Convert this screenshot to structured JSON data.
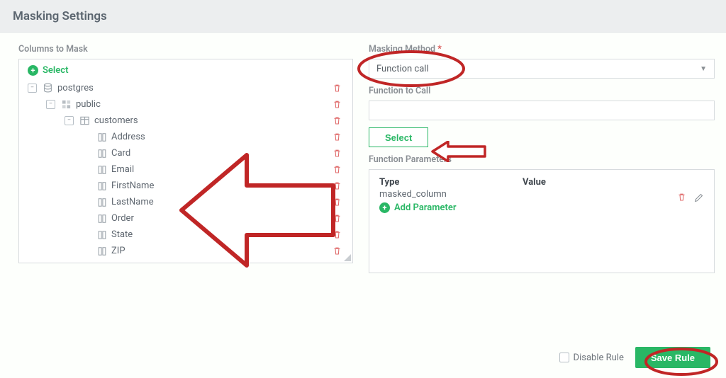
{
  "header": {
    "title": "Masking Settings"
  },
  "left": {
    "label": "Columns to Mask",
    "select_label": "Select",
    "tree": {
      "db": "postgres",
      "schema": "public",
      "table": "customers",
      "columns": [
        "Address",
        "Card",
        "Email",
        "FirstName",
        "LastName",
        "Order",
        "State",
        "ZIP"
      ]
    }
  },
  "right": {
    "method_label": "Masking Method",
    "method_value": "Function call",
    "func_label": "Function to Call",
    "func_value": "",
    "select_btn": "Select",
    "params_label": "Function Parameters",
    "params_header_type": "Type",
    "params_header_value": "Value",
    "param_rows": [
      {
        "type": "masked_column",
        "value": ""
      }
    ],
    "add_param_label": "Add Parameter"
  },
  "footer": {
    "disable_label": "Disable Rule",
    "save_label": "Save Rule"
  }
}
